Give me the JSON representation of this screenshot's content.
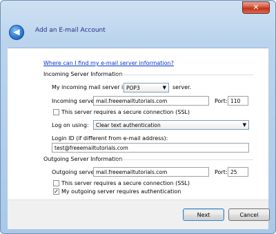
{
  "window": {
    "title": "Add an E-mail Account",
    "close_label": "✕",
    "back_label": "◀"
  },
  "help_link": "Where can I find my e-mail server information?",
  "incoming": {
    "section_title": "Incoming Server Information",
    "mail_server_label": "My incoming mail server is a",
    "server_type": "POP3",
    "server_suffix": "server.",
    "incoming_server_label": "Incoming server:",
    "incoming_server_value": "mail.freeemailtutorials.com",
    "port_label": "Port:",
    "port_value": "110",
    "ssl_label": "This server requires a secure connection (SSL)",
    "ssl_checked": false,
    "logon_label": "Log on using:",
    "logon_value": "Clear text authentication",
    "login_id_label": "Login ID (if different from e-mail address):",
    "login_id_value": "test@freeemailtutorials.com"
  },
  "outgoing": {
    "section_title": "Outgoing Server Information",
    "outgoing_server_label": "Outgoing server:",
    "outgoing_server_value": "mail.freeemailtutorials.com",
    "port_label": "Port:",
    "port_value": "25",
    "ssl_label": "This server requires a secure connection (SSL)",
    "ssl_checked": false,
    "auth_label": "My outgoing server requires authentication",
    "auth_checked": true
  },
  "buttons": {
    "next": "Next",
    "cancel": "Cancel"
  }
}
